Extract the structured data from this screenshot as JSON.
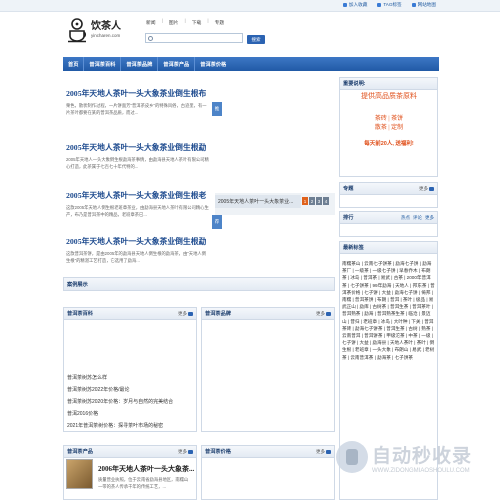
{
  "top_links": [
    "加入收藏",
    "TAG标签",
    "网站地图"
  ],
  "logo": {
    "cn": "饮茶人",
    "en": "yincharen.com"
  },
  "search": {
    "tabs": [
      "新闻",
      "图片",
      "下载",
      "专题"
    ],
    "placeholder": "",
    "button": "搜索"
  },
  "nav": [
    "首页",
    "普洱茶百科",
    "普洱茶品牌",
    "普洱茶产品",
    "普洱茶价格"
  ],
  "articles": [
    {
      "title": "2005年天地人茶叶一头大象茶业倒生根布",
      "body": "栗色，散状制作过程，一片饼面芳\"普洱茶皮乡\"的特殊风俗，古迹里，有一片茶叶都要在某的普洱茶品质，而过..."
    },
    {
      "title": "2005年天地人茶叶一头大象茶业倒生根勐",
      "body": "2005年天地人一头大象倒生根勐海茶事情，由勐海县天地人茶叶有限公司精心打造，此茶属于七百七十年代特的..."
    },
    {
      "title": "2005年天地人茶叶一头大象茶业倒生根老",
      "body": "这款2005年天地人倒生根老班章茶业，由勐海县天地人茶叶有限公司精心生产，布乃是普洱茶中的精品，老班章茶已..."
    },
    {
      "title": "2005年天地人茶叶一头大象茶业倒生根勐",
      "body": "这款普洱茶饼，是由2005年的勐海县天地人倒生根的勐海茶，由\"天地人倒生根\"的精湛工艺打造，它选用了勐海..."
    }
  ],
  "slide": {
    "caption": "2005年天地人茶叶一头大象茶业...",
    "pages": [
      "1",
      "2",
      "3",
      "4"
    ]
  },
  "side_labels": [
    "推",
    "荐"
  ],
  "case_title": "案例展示",
  "mid_panels": [
    {
      "title": "普洱茶百科",
      "more": "更多",
      "items": [
        "普洱茶树苏怎么样",
        "普洱茶树苏2022年价格/最论",
        "普洱茶树苏2020年价格：岁月与自然的完美结合",
        "普洱2016价格",
        "2021年普洱茶树价格：探寻茶叶市场的秘密"
      ]
    },
    {
      "title": "普洱茶品牌",
      "more": "更多",
      "items": []
    },
    {
      "title": "普洱茶产品",
      "more": "更多",
      "items": []
    },
    {
      "title": "普洱茶价格",
      "more": "更多",
      "items": []
    }
  ],
  "sidebar": {
    "notice": {
      "title": "重要说明:",
      "lines": [
        "提供高品质茶原料",
        "茶砖 | 茶饼",
        "散茶 | 定制"
      ],
      "highlight": "每天前20人, 送福利!"
    },
    "topics": {
      "title": "专题",
      "more": "更多"
    },
    "rank": {
      "title": "排行",
      "tabs": [
        "热点",
        "评论",
        "更多"
      ]
    },
    "tags": {
      "title": "最新标签",
      "text": "南糯茶山 | 云南七子饼茶 | 勐海七子饼 | 勐海茶厂 | 一级茶 | 一级七子饼 | 早春乔木 | 布朗茶 | 冰岛 | 普洱茶 | 易武 | 古茶 | 2000年普洱茶 | 七子饼茶 | 99年勐海 | 天地人 | 邦东茶 | 普洱茶价格 | 七子饼 | 大益 | 勐海七子饼 | 倚邦 | 南糯 | 普洱茶饼 | 布朗 | 普洱 | 茶叶 | 极品 | 易武正山 | 勐库 | 古树茶 | 普洱生茶 | 普洱茶叶 | 普洱熟茶 | 勐海 | 普洱熟茶生茶 | 临沧 | 景迈山 | 昔归 | 老班章 | 冰岛 | 大叶种 | 下关 | 普洱茶砖 | 勐海七子饼茶 | 普洱生茶 | 古树 | 熟茶 | 云南普洱 | 普洱饼茶 | 甲级沱茶 | 中茶 | 一级 | 七子饼 | 大益 | 勐海县 | 天地人茶叶 | 茶叶 | 倒生根 | 老班章 | 一头大象 | 布朗山 | 易武 | 老树茶 | 云南普洱茶 | 勐海茶 | 七子饼茶"
    }
  },
  "product": {
    "title": "2006年天地人茶叶一头大象茶...",
    "body": "质量营业执照，位于云南省勐海县地区，南糯山一带的茶人传承千年的传统工艺，..."
  },
  "watermark": {
    "cn": "自动秒收录",
    "en": "WWW.ZIDONGMIAOSHOULU.COM"
  }
}
